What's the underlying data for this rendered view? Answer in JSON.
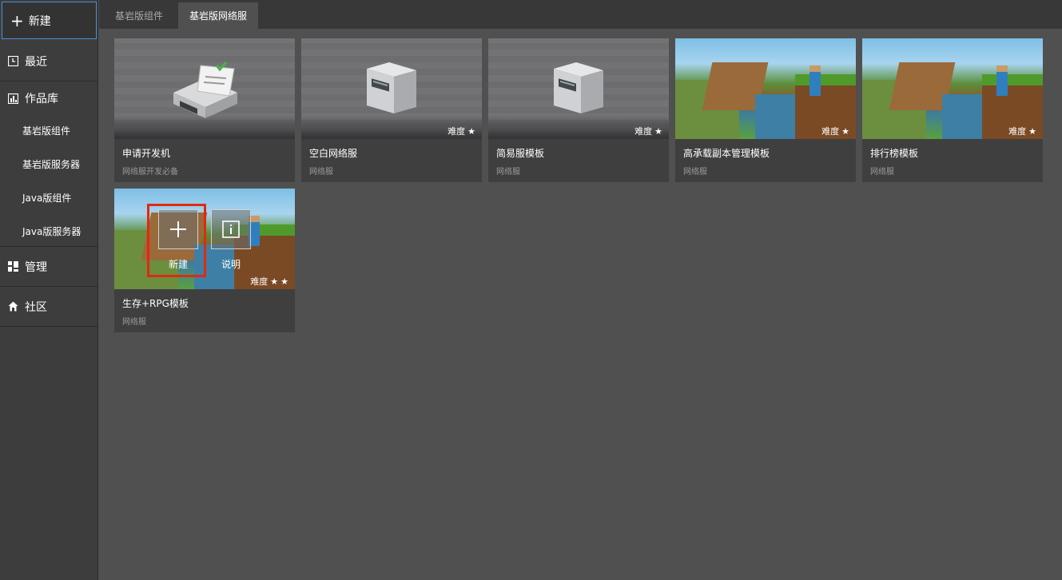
{
  "sidebar": {
    "new_label": "新建",
    "items": [
      {
        "label": "最近",
        "icon": "clock-icon"
      },
      {
        "label": "作品库",
        "icon": "library-icon"
      },
      {
        "label": "管理",
        "icon": "dashboard-icon"
      },
      {
        "label": "社区",
        "icon": "home-icon"
      }
    ],
    "sub_items": [
      "基岩版组件",
      "基岩版服务器",
      "Java版组件",
      "Java版服务器"
    ]
  },
  "tabs": [
    {
      "label": "基岩版组件",
      "active": false
    },
    {
      "label": "基岩版网络服",
      "active": true
    }
  ],
  "cards": [
    {
      "title": "申请开发机",
      "subtitle": "网络服开发必备",
      "difficulty": "",
      "stars": 0,
      "thumb": "dev-machine-icon"
    },
    {
      "title": "空白网络服",
      "subtitle": "网络服",
      "difficulty": "难度",
      "stars": 1,
      "thumb": "server-icon"
    },
    {
      "title": "简易服模板",
      "subtitle": "网络服",
      "difficulty": "难度",
      "stars": 1,
      "thumb": "server-icon"
    },
    {
      "title": "高承载副本管理模板",
      "subtitle": "网络服",
      "difficulty": "难度",
      "stars": 1,
      "thumb": "minecraft-landscape"
    },
    {
      "title": "排行榜模板",
      "subtitle": "网络服",
      "difficulty": "难度",
      "stars": 1,
      "thumb": "minecraft-landscape"
    },
    {
      "title": "生存+RPG模板",
      "subtitle": "网络服",
      "difficulty": "难度",
      "stars": 2,
      "thumb": "minecraft-landscape"
    }
  ],
  "overlay": {
    "new_label": "新建",
    "info_label": "说明"
  },
  "colors": {
    "background": "#505050",
    "sidebar": "#3d3d3d",
    "card": "#3f3f3f",
    "highlight_border": "#e02a10",
    "selected_border": "#4a90d9"
  }
}
